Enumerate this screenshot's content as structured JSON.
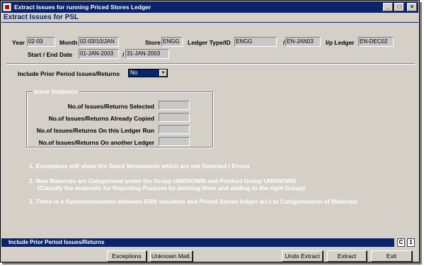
{
  "window": {
    "title": "Extract Issues for running Priced Stores Ledger",
    "heading": "Extract Issues for PSL",
    "controls": {
      "minimize": "_",
      "maximize": "□",
      "close": "×"
    }
  },
  "form": {
    "year_label": "Year",
    "year_value": "02-03",
    "month_label": "Month",
    "month_value": "02-03/10/JAN",
    "store_label": "Store",
    "store_value": "ENGG",
    "ledger_type_label": "Ledger Type/ID",
    "ledger_type_value": "ENGG",
    "ledger_id_slash": "/",
    "ledger_id_value": "EN-JAN03",
    "ip_ledger_label": "I/p Ledger",
    "ip_ledger_value": "EN-DEC02",
    "date_label": "Start / End Date",
    "start_date": "01-JAN-2003",
    "date_slash": "/",
    "end_date": "31-JAN-2003",
    "prior_label": "Include Prior Period Issues/Returns",
    "prior_value": "No"
  },
  "issue_stats": {
    "legend": "Issue Statistics",
    "rows": [
      {
        "label": "No.of Issues/Returns Selected",
        "value": ""
      },
      {
        "label": "No.of Issues/Returns Already Copied",
        "value": ""
      },
      {
        "label": "No.of Issues/Returns On this Ledger Run",
        "value": ""
      },
      {
        "label": "No.of Issues/Returns On another Ledger",
        "value": ""
      }
    ]
  },
  "notes": {
    "n1": "1.  Exceptions will show the Stock Movements which are not Selected / Errors",
    "n2": "2.  New Materials are Categorised under the Group UNKNOWN and Product Group UNKNOWN",
    "n2b": "(Classify the materials for Reporting Purpose by deleting them and adding to the right Group)",
    "n3": "3.  There is a Synochronisation between GRN valuation and Priced Stores ledger w.r.t to Categorisation of Materials"
  },
  "status": {
    "text": "Include Prior Period Issues/Returns",
    "box1": "C",
    "box2": "1"
  },
  "buttons": {
    "exceptions": "Exceptions",
    "unknown": "Unknown Matl.",
    "undo": "Undo Extract",
    "extract": "Extract",
    "exit": "Exit"
  },
  "colors": {
    "titlebar": "#0a246a",
    "window_bg": "#d4d0c8",
    "field_bg": "#c8c8c8",
    "note_text": "#ffffff"
  }
}
